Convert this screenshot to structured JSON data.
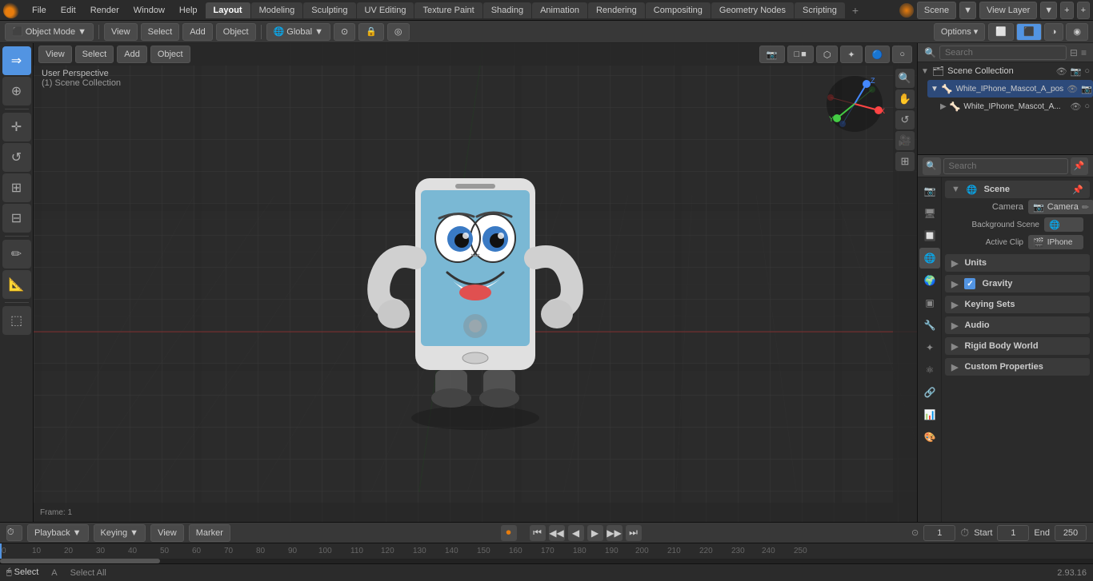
{
  "app": {
    "title": "Blender",
    "version": "2.93.16"
  },
  "menubar": {
    "items": [
      "Blender",
      "File",
      "Edit",
      "Render",
      "Window",
      "Help"
    ]
  },
  "workspace_tabs": {
    "tabs": [
      "Layout",
      "Modeling",
      "Sculpting",
      "UV Editing",
      "Texture Paint",
      "Shading",
      "Animation",
      "Rendering",
      "Compositing",
      "Geometry Nodes",
      "Scripting"
    ],
    "active": "Layout",
    "add_label": "+"
  },
  "header": {
    "object_mode_label": "Object Mode",
    "view_label": "View",
    "select_label": "Select",
    "add_label": "Add",
    "object_label": "Object",
    "transform_label": "Global",
    "options_label": "Options ▾"
  },
  "viewport": {
    "view_label": "User Perspective",
    "collection_label": "(1) Scene Collection",
    "background_color": "#2b2b2b"
  },
  "outliner": {
    "title": "Scene Collection",
    "search_placeholder": "Search",
    "items": [
      {
        "label": "White_IPhone_Mascot_A_pos",
        "depth": 1,
        "expanded": true
      },
      {
        "label": "White_IPhone_Mascot_A...",
        "depth": 2
      }
    ]
  },
  "properties": {
    "search_placeholder": "Search",
    "scene_label": "Scene",
    "scene_section": "Scene",
    "camera_label": "Camera",
    "camera_value": "Camera",
    "background_scene_label": "Background Scene",
    "active_clip_label": "Active Clip",
    "iphone_label": "IPhone",
    "units_label": "Units",
    "gravity_label": "Gravity",
    "gravity_checked": true,
    "keying_sets_label": "Keying Sets",
    "audio_label": "Audio",
    "rigid_body_world_label": "Rigid Body World",
    "custom_properties_label": "Custom Properties"
  },
  "timeline": {
    "playback_label": "Playback",
    "keying_label": "Keying",
    "view_label": "View",
    "marker_label": "Marker",
    "frame_label": "1",
    "start_label": "Start",
    "start_value": "1",
    "end_label": "End",
    "end_value": "250",
    "frame_numbers": [
      "0",
      "10",
      "20",
      "30",
      "40",
      "50",
      "60",
      "70",
      "80",
      "90",
      "100",
      "110",
      "120",
      "130",
      "140",
      "150",
      "160",
      "170",
      "180",
      "190",
      "200",
      "210",
      "220",
      "230",
      "240",
      "250"
    ]
  },
  "status": {
    "left": "Select",
    "shortcut": "A",
    "version": "2.93.16"
  }
}
